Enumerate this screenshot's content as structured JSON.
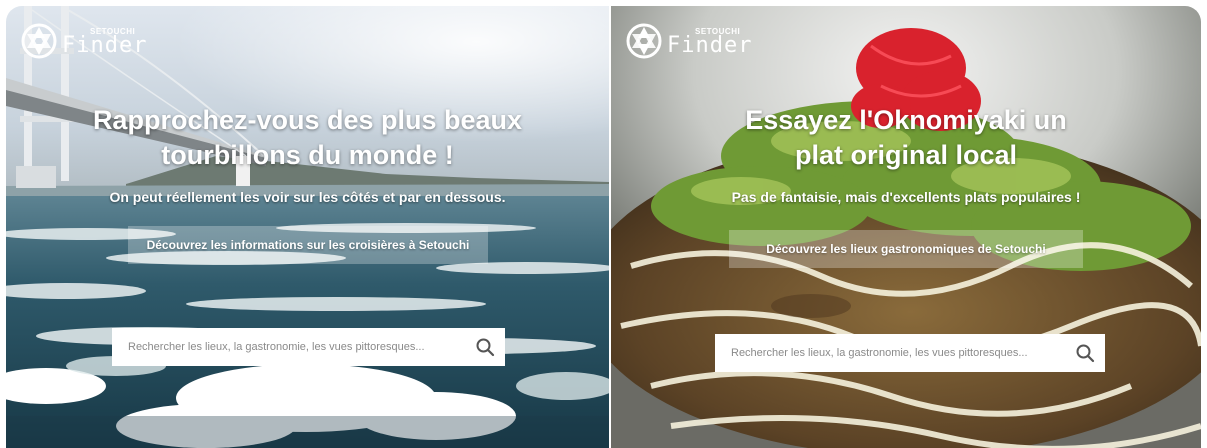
{
  "panels": [
    {
      "logo_small": "SETOUCHI",
      "logo_big": "Finder",
      "headline": "Rapprochez-vous des plus beaux tourbillons du monde !",
      "subtitle": "On peut réellement les voir sur les côtés et par en dessous.",
      "cta_label": "Découvrez les informations sur les croisières à Setouchi",
      "search_placeholder": "Rechercher les lieux, la gastronomie, les vues pittoresques...",
      "icon": "search-icon"
    },
    {
      "logo_small": "SETOUCHI",
      "logo_big": "Finder",
      "headline": "Essayez l'Oknomiyaki un plat original local",
      "subtitle": "Pas de fantaisie, mais d'excellents plats populaires !",
      "cta_label": "Découvrez les lieux gastronomiques de Setouchi",
      "search_placeholder": "Rechercher les lieux, la gastronomie, les vues pittoresques...",
      "icon": "search-icon"
    }
  ],
  "colors": {
    "sea_dark": "#1f4556",
    "sea_mid": "#3d6f80",
    "foam": "#eef3f4",
    "sky": "#c9d6e0",
    "food_green": "#6d8a3a",
    "ginger_red": "#d8202b",
    "search_bg": "#ffffff",
    "text_white": "#ffffff"
  }
}
